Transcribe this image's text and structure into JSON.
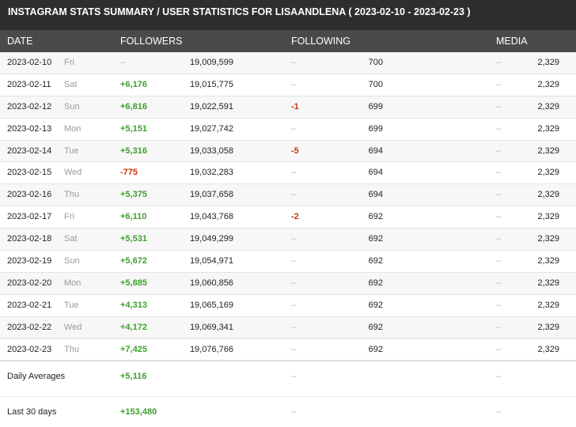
{
  "title": "INSTAGRAM STATS SUMMARY / USER STATISTICS FOR LISAANDLENA ( 2023-02-10 - 2023-02-23 )",
  "headers": {
    "date": "DATE",
    "followers": "FOLLOWERS",
    "following": "FOLLOWING",
    "media": "MEDIA"
  },
  "rows": [
    {
      "date": "2023-02-10",
      "day": "Fri",
      "followers_change": "–",
      "followers": "19,009,599",
      "following_change": "–",
      "following": "700",
      "media_change": "–",
      "media": "2,329"
    },
    {
      "date": "2023-02-11",
      "day": "Sat",
      "followers_change": "+6,176",
      "followers": "19,015,775",
      "following_change": "–",
      "following": "700",
      "media_change": "–",
      "media": "2,329"
    },
    {
      "date": "2023-02-12",
      "day": "Sun",
      "followers_change": "+6,816",
      "followers": "19,022,591",
      "following_change": "-1",
      "following": "699",
      "media_change": "–",
      "media": "2,329"
    },
    {
      "date": "2023-02-13",
      "day": "Mon",
      "followers_change": "+5,151",
      "followers": "19,027,742",
      "following_change": "–",
      "following": "699",
      "media_change": "–",
      "media": "2,329"
    },
    {
      "date": "2023-02-14",
      "day": "Tue",
      "followers_change": "+5,316",
      "followers": "19,033,058",
      "following_change": "-5",
      "following": "694",
      "media_change": "–",
      "media": "2,329"
    },
    {
      "date": "2023-02-15",
      "day": "Wed",
      "followers_change": "-775",
      "followers": "19,032,283",
      "following_change": "–",
      "following": "694",
      "media_change": "–",
      "media": "2,329"
    },
    {
      "date": "2023-02-16",
      "day": "Thu",
      "followers_change": "+5,375",
      "followers": "19,037,658",
      "following_change": "–",
      "following": "694",
      "media_change": "–",
      "media": "2,329"
    },
    {
      "date": "2023-02-17",
      "day": "Fri",
      "followers_change": "+6,110",
      "followers": "19,043,768",
      "following_change": "-2",
      "following": "692",
      "media_change": "–",
      "media": "2,329"
    },
    {
      "date": "2023-02-18",
      "day": "Sat",
      "followers_change": "+5,531",
      "followers": "19,049,299",
      "following_change": "–",
      "following": "692",
      "media_change": "–",
      "media": "2,329"
    },
    {
      "date": "2023-02-19",
      "day": "Sun",
      "followers_change": "+5,672",
      "followers": "19,054,971",
      "following_change": "–",
      "following": "692",
      "media_change": "–",
      "media": "2,329"
    },
    {
      "date": "2023-02-20",
      "day": "Mon",
      "followers_change": "+5,885",
      "followers": "19,060,856",
      "following_change": "–",
      "following": "692",
      "media_change": "–",
      "media": "2,329"
    },
    {
      "date": "2023-02-21",
      "day": "Tue",
      "followers_change": "+4,313",
      "followers": "19,065,169",
      "following_change": "–",
      "following": "692",
      "media_change": "–",
      "media": "2,329"
    },
    {
      "date": "2023-02-22",
      "day": "Wed",
      "followers_change": "+4,172",
      "followers": "19,069,341",
      "following_change": "–",
      "following": "692",
      "media_change": "–",
      "media": "2,329"
    },
    {
      "date": "2023-02-23",
      "day": "Thu",
      "followers_change": "+7,425",
      "followers": "19,076,766",
      "following_change": "–",
      "following": "692",
      "media_change": "–",
      "media": "2,329"
    }
  ],
  "daily_averages": {
    "label": "Daily Averages",
    "followers_change": "+5,116",
    "following_change": "–",
    "media_change": "–"
  },
  "last_30_days": {
    "label": "Last 30 days",
    "followers_change": "+153,480",
    "following_change": "–",
    "media_change": "–"
  },
  "colors": {
    "positive": "#3fa02f",
    "negative": "#d03010",
    "header_bg": "#4a4a4a",
    "title_bg": "#2e2e2e"
  }
}
